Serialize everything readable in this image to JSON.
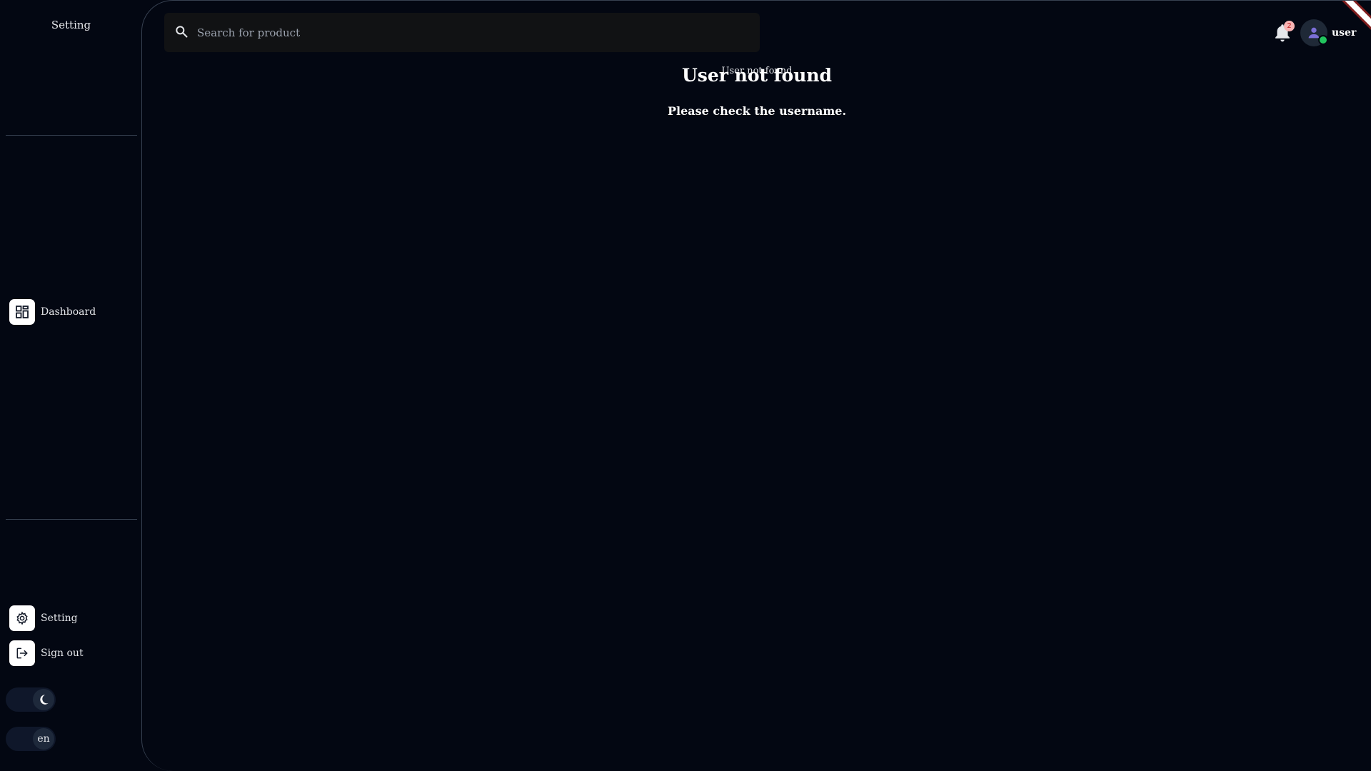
{
  "sidebar": {
    "title": "Setting",
    "nav": {
      "dashboard": {
        "label": "Dashboard",
        "icon": "dashboard-grid-icon"
      },
      "setting": {
        "label": "Setting",
        "icon": "gear-icon"
      },
      "signout": {
        "label": "Sign out",
        "icon": "logout-icon"
      }
    },
    "theme_toggle": {
      "icon": "moon-icon"
    },
    "language_toggle": {
      "value": "en"
    }
  },
  "header": {
    "search": {
      "placeholder": "Search for product",
      "value": ""
    },
    "notifications": {
      "count": "2",
      "icon": "bell-icon"
    },
    "user": {
      "name": "user",
      "status_color": "#22c55e"
    }
  },
  "content": {
    "overlay_text": "User not found",
    "title": "User not found",
    "message": "Please check the username."
  },
  "colors": {
    "background": "#030712",
    "border": "#374151",
    "accent_online": "#22c55e",
    "badge": "#f8b4b4"
  }
}
